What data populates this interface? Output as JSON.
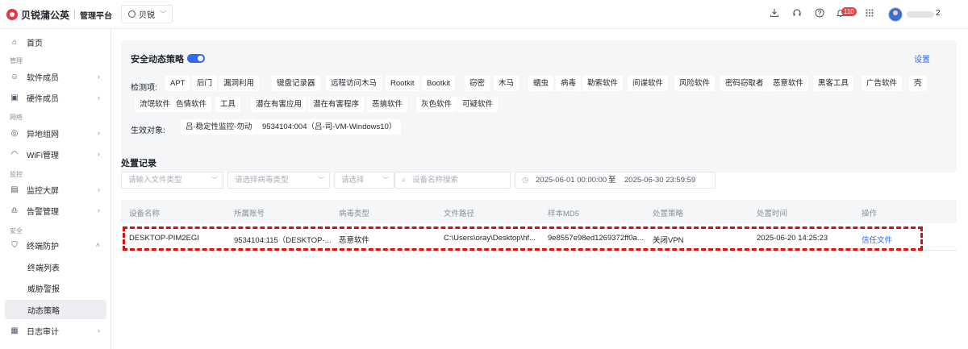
{
  "brand": {
    "name": "贝锐蒲公英",
    "subtitle": "管理平台",
    "logo_color": "#e8344a"
  },
  "header": {
    "org_selector": "贝锐",
    "icons": [
      "download-icon",
      "headset-icon",
      "help-icon",
      "bell-icon",
      "apps-grid-icon"
    ],
    "notification_count": "110",
    "user_suffix": "2"
  },
  "sidebar": {
    "home": "首页",
    "groups": {
      "manage": "管理",
      "network": "网络",
      "monitor": "监控",
      "security": "安全"
    },
    "items": {
      "software": "软件成员",
      "hardware": "硬件成员",
      "remote_network": "异地组网",
      "wifi": "WiFi管理",
      "monitor_screen": "监控大屏",
      "alerts": "告警管理",
      "endpoint": "终端防护",
      "endpoint_list": "终端列表",
      "threat_alerts": "威胁警报",
      "dynamic_policy": "动态策略",
      "audit_log": "日志审计"
    }
  },
  "policy": {
    "title": "安全动态策略",
    "enabled": true,
    "settings": "设置",
    "detect_label": "检测项:",
    "detect_items": [
      "APT",
      "后门",
      "漏洞利用",
      "键盘记录器",
      "远程访问木马",
      "Rootkit",
      "Bootkit",
      "窃密",
      "木马",
      "蠕虫",
      "病毒",
      "勒索软件",
      "间谍软件",
      "风险软件",
      "密码窃取者",
      "恶意软件",
      "黑客工具",
      "广告软件",
      "壳",
      "流氓软件",
      "色情软件",
      "工具",
      "潜在有害应用",
      "潜在有害程序",
      "恶搞软件",
      "灰色软件",
      "可疑软件"
    ],
    "target_label": "生效对象:",
    "targets": [
      "吕-稳定性监控-勿动",
      "9534104:004（吕-司-VM-Windows10）"
    ]
  },
  "records": {
    "title": "处置记录",
    "filters": {
      "file_type": "请输入文件类型",
      "virus_type": "请选择病毒类型",
      "select": "请选择",
      "device_search": "设备名称搜索"
    },
    "date_start": "2025-06-01 00:00:00",
    "date_to": "至",
    "date_end": "2025-06-30 23:59:59",
    "columns": [
      "设备名称",
      "所属账号",
      "病毒类型",
      "文件路径",
      "样本MD5",
      "处置策略",
      "处置时间",
      "操作"
    ],
    "rows": [
      {
        "device": "DESKTOP-PIM2EGI",
        "account": "9534104:115（DESKTOP-...",
        "virus_type": "恶意软件",
        "path": "C:\\Users\\oray\\Desktop\\hf...",
        "md5": "9e8557e98ed1269372ff0a...",
        "strategy": "关闭VPN",
        "time": "2025-06-20 14:25:23",
        "action": "信任文件"
      }
    ]
  },
  "colors": {
    "accent": "#2f6bec",
    "highlight": "#e30c0c",
    "badge": "#f53f3f"
  }
}
